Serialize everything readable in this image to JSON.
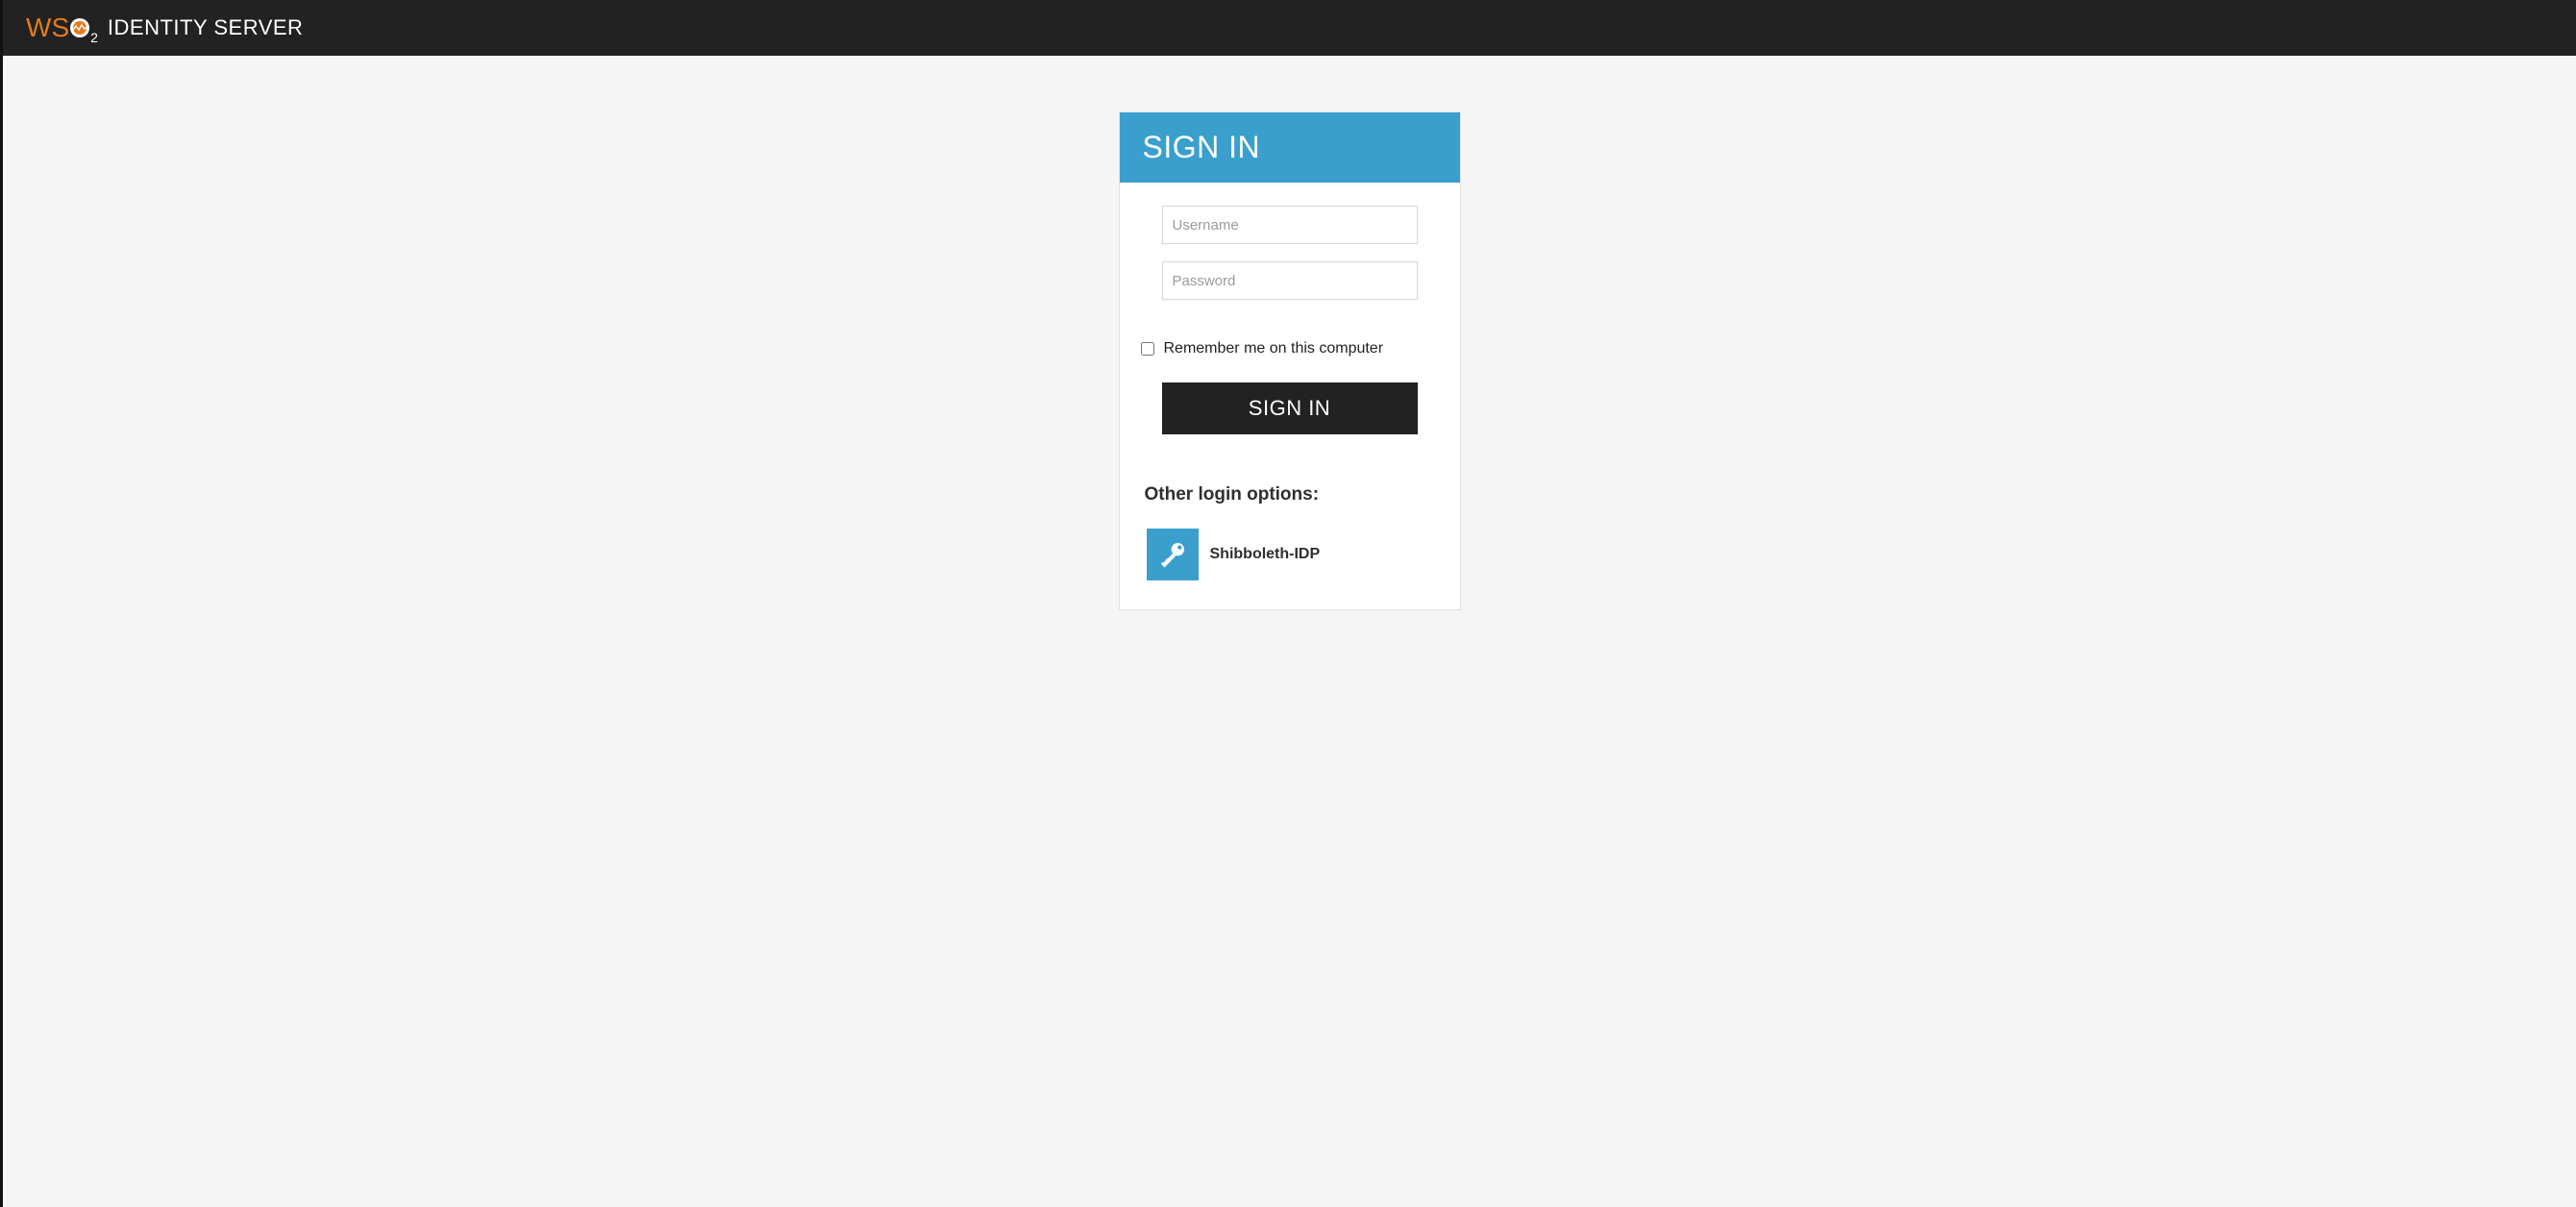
{
  "header": {
    "product_name": "IDENTITY SERVER"
  },
  "login": {
    "title": "SIGN IN",
    "username_placeholder": "Username",
    "username_value": "",
    "password_placeholder": "Password",
    "password_value": "",
    "remember_label": "Remember me on this computer",
    "remember_checked": false,
    "submit_label": "SIGN IN"
  },
  "other": {
    "heading": "Other login options:",
    "providers": [
      {
        "name": "Shibboleth-IDP",
        "icon": "key-icon"
      }
    ]
  },
  "colors": {
    "accent": "#3b9fce",
    "header_bg": "#222222",
    "logo_orange": "#e27b1e"
  }
}
